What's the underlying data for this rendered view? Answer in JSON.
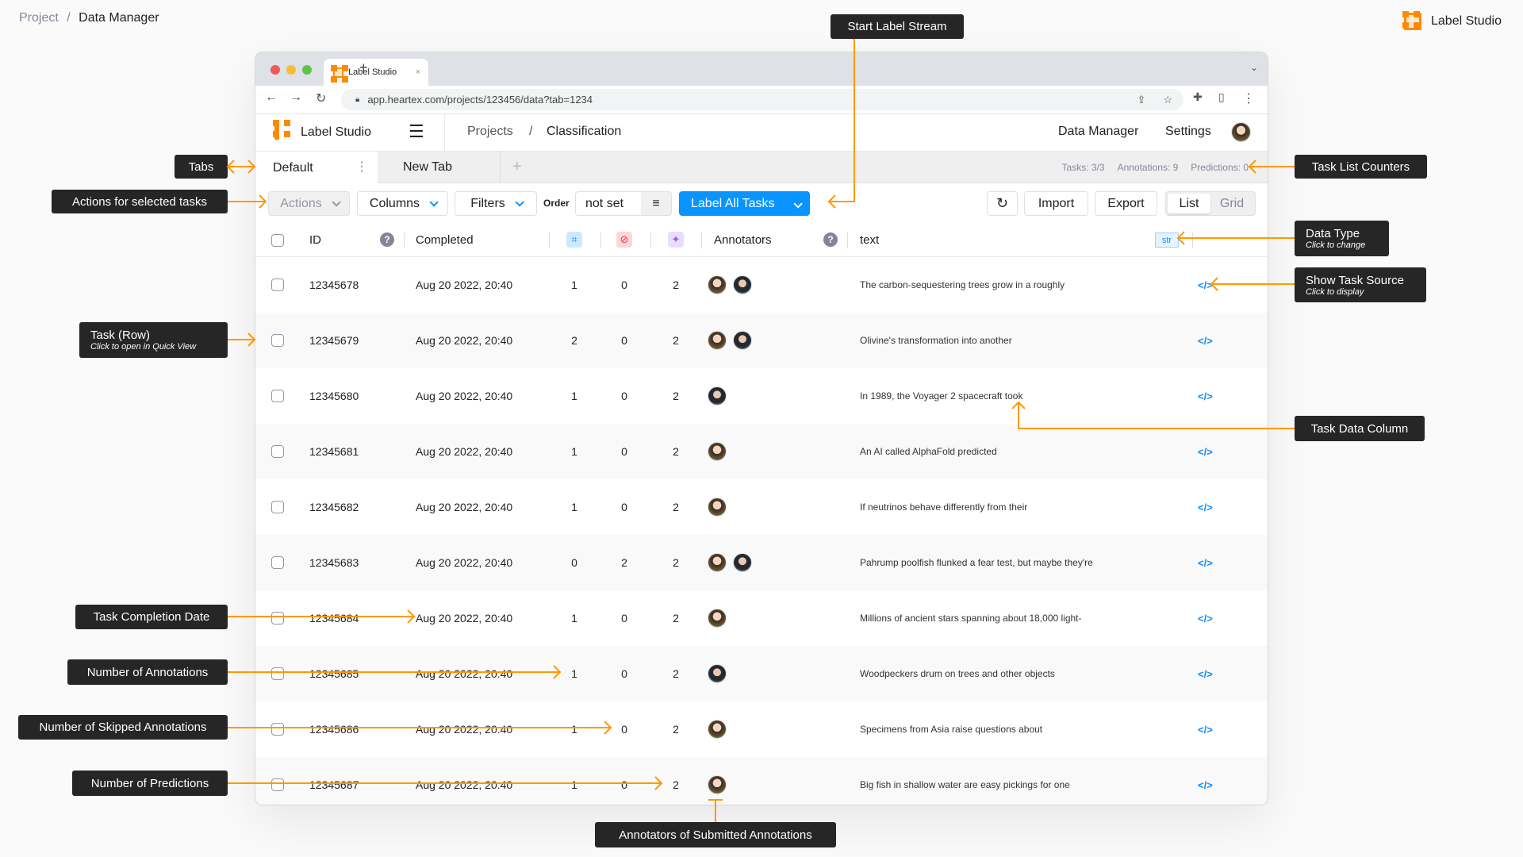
{
  "page_breadcrumb": {
    "parent": "Project",
    "separator": "/",
    "current": "Data Manager"
  },
  "brand": {
    "name": "Label Studio"
  },
  "browser": {
    "tab_title": "Label Studio",
    "url": "app.heartex.com/projects/123456/data?tab=1234"
  },
  "app": {
    "name": "Label Studio",
    "breadcrumb": {
      "projects": "Projects",
      "sep": "/",
      "project": "Classification"
    },
    "nav": {
      "data_manager": "Data Manager",
      "settings": "Settings"
    }
  },
  "tabs": [
    {
      "label": "Default",
      "active": true
    },
    {
      "label": "New Tab",
      "active": false
    }
  ],
  "counters": {
    "tasks": "Tasks: 3/3",
    "annotations": "Annotations: 9",
    "predictions": "Predictions: 0"
  },
  "toolbar": {
    "actions": "Actions",
    "columns": "Columns",
    "filters": "Filters",
    "order_label": "Order",
    "order_value": "not set",
    "label_all": "Label All Tasks",
    "import": "Import",
    "export": "Export",
    "view_list": "List",
    "view_grid": "Grid",
    "view_active": "List",
    "accent": "#0a94ff"
  },
  "columns": {
    "id": "ID",
    "completed": "Completed",
    "annotators": "Annotators",
    "text": "text",
    "text_type": "str"
  },
  "rows": [
    {
      "id": "12345678",
      "completed": "Aug 20 2022, 20:40",
      "annotations": "1",
      "skipped": "0",
      "predictions": "2",
      "annotators": [
        "woman",
        "man"
      ],
      "text": "The carbon-sequestering trees grow in a roughly"
    },
    {
      "id": "12345679",
      "completed": "Aug 20 2022, 20:40",
      "annotations": "2",
      "skipped": "0",
      "predictions": "2",
      "annotators": [
        "woman",
        "man"
      ],
      "text": "Olivine's transformation into another"
    },
    {
      "id": "12345680",
      "completed": "Aug 20 2022, 20:40",
      "annotations": "1",
      "skipped": "0",
      "predictions": "2",
      "annotators": [
        "man"
      ],
      "text": "In 1989, the Voyager 2 spacecraft took"
    },
    {
      "id": "12345681",
      "completed": "Aug 20 2022, 20:40",
      "annotations": "1",
      "skipped": "0",
      "predictions": "2",
      "annotators": [
        "woman"
      ],
      "text": "An AI called AlphaFold predicted"
    },
    {
      "id": "12345682",
      "completed": "Aug 20 2022, 20:40",
      "annotations": "1",
      "skipped": "0",
      "predictions": "2",
      "annotators": [
        "woman"
      ],
      "text": "If neutrinos behave differently from their"
    },
    {
      "id": "12345683",
      "completed": "Aug 20 2022, 20:40",
      "annotations": "0",
      "skipped": "2",
      "predictions": "2",
      "annotators": [
        "woman",
        "man"
      ],
      "text": "Pahrump poolfish flunked a fear test, but maybe they're"
    },
    {
      "id": "12345684",
      "completed": "Aug 20 2022, 20:40",
      "annotations": "1",
      "skipped": "0",
      "predictions": "2",
      "annotators": [
        "woman"
      ],
      "text": "Millions of ancient stars spanning about 18,000 light-"
    },
    {
      "id": "12345685",
      "completed": "Aug 20 2022, 20:40",
      "annotations": "1",
      "skipped": "0",
      "predictions": "2",
      "annotators": [
        "man"
      ],
      "text": "Woodpeckers drum on trees and other objects"
    },
    {
      "id": "12345686",
      "completed": "Aug 20 2022, 20:40",
      "annotations": "1",
      "skipped": "0",
      "predictions": "2",
      "annotators": [
        "woman"
      ],
      "text": "Specimens from Asia raise questions about"
    },
    {
      "id": "12345687",
      "completed": "Aug 20 2022, 20:40",
      "annotations": "1",
      "skipped": "0",
      "predictions": "2",
      "annotators": [
        "woman"
      ],
      "text": "Big fish in shallow water are easy pickings for one"
    }
  ],
  "callouts": {
    "start_stream": "Start Label Stream",
    "tabs": "Tabs",
    "actions": "Actions for selected tasks",
    "counters": "Task List Counters",
    "data_type": "Data Type",
    "data_type_hint": "Click to change",
    "task_source": "Show Task Source",
    "task_source_hint": "Click to display",
    "task_row": "Task (Row)",
    "task_row_hint": "Click to open in Quick View",
    "data_column": "Task Data Column",
    "completion_date": "Task Completion Date",
    "num_annotations": "Number of Annotations",
    "num_skipped": "Number of Skipped Annotations",
    "num_predictions": "Number of Predictions",
    "annotators": "Annotators of Submitted Annotations",
    "color": "#ff9800"
  }
}
